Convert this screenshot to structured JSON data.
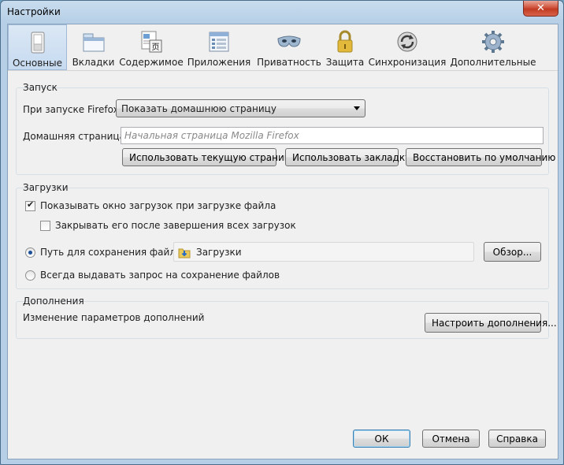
{
  "window": {
    "title": "Настройки",
    "close": "✕"
  },
  "tabs": [
    {
      "label": "Основные",
      "icon": "general-switch-icon",
      "selected": true
    },
    {
      "label": "Вкладки",
      "icon": "tabs-window-icon",
      "selected": false
    },
    {
      "label": "Содержимое",
      "icon": "content-page-icon",
      "selected": false
    },
    {
      "label": "Приложения",
      "icon": "applications-list-icon",
      "selected": false
    },
    {
      "label": "Приватность",
      "icon": "privacy-mask-icon",
      "selected": false
    },
    {
      "label": "Защита",
      "icon": "security-lock-icon",
      "selected": false
    },
    {
      "label": "Синхронизация",
      "icon": "sync-arrows-icon",
      "selected": false
    },
    {
      "label": "Дополнительные",
      "icon": "advanced-gear-icon",
      "selected": false
    }
  ],
  "startup": {
    "title": "Запуск",
    "when_label": "При запуске Firefox:",
    "when_value": "Показать домашнюю страницу",
    "home_label": "Домашняя страница:",
    "home_value": "",
    "home_placeholder": "Начальная страница Mozilla Firefox",
    "use_current": "Использовать текущую страницу",
    "use_bookmark": "Использовать закладку",
    "restore_default": "Восстановить по умолчанию"
  },
  "downloads": {
    "title": "Загрузки",
    "show_window": "Показывать окно загрузок при загрузке файла",
    "show_window_checked": true,
    "close_when_done": "Закрывать его после завершения всех загрузок",
    "close_when_done_checked": false,
    "save_to_label": "Путь для сохранения файлов",
    "save_to_selected": true,
    "folder": "Загрузки",
    "browse": "Обзор...",
    "always_ask": "Всегда выдавать запрос на сохранение файлов",
    "always_ask_selected": false
  },
  "addons": {
    "title": "Дополнения",
    "description": "Изменение параметров дополнений",
    "manage": "Настроить дополнения..."
  },
  "footer": {
    "ok": "ОК",
    "cancel": "Отмена",
    "help": "Справка"
  },
  "colors": {
    "selected_tab": "#c6daf0",
    "accent": "#3c7fb1"
  }
}
